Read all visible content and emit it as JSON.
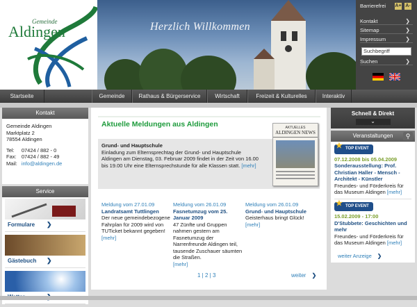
{
  "header": {
    "logo_line1": "Gemeinde",
    "logo_line2": "Aldingen",
    "welcome": "Herzlich Willkommen"
  },
  "util": {
    "barrierefrei": "Barrierefrei",
    "font_plus": "A+",
    "font_minus": "A-",
    "links": [
      "Kontakt",
      "Sitemap",
      "Impressum"
    ],
    "search_placeholder": "Suchbegriff",
    "search_button": "Suchen"
  },
  "nav": {
    "items": [
      "Startseite",
      "Gemeinde",
      "Rathaus & Bürgerservice",
      "Wirtschaft",
      "Freizeit & Kulturelles",
      "Interaktiv"
    ]
  },
  "contact": {
    "heading": "Kontakt",
    "name": "Gemeinde Aldingen",
    "street": "Marktplatz 2",
    "city": "78554 Aldingen",
    "tel_label": "Tel:",
    "tel": "07424 / 882 - 0",
    "fax_label": "Fax:",
    "fax": "07424 / 882 - 49",
    "mail_label": "Mail:",
    "mail": "info@aldingen.de"
  },
  "service": {
    "heading": "Service",
    "items": [
      "Formulare",
      "Gästebuch",
      "Wetter"
    ]
  },
  "main": {
    "title": "Aktuelle Meldungen aus Aldingen",
    "lead": {
      "title": "Grund- und Hauptschule",
      "body": "Einladung zum Elternsprechtag der Grund- und Hauptschule Aldingen am Dienstag, 03. Februar 2009 findet in der Zeit von 16.00 bis 19.00 Uhr eine Elternsprechstunde für alle Klassen statt.",
      "more": "[mehr]"
    },
    "paper_top": "AKTUELLES",
    "paper_title": "ALDINGEN NEWS",
    "news": [
      {
        "date": "Meldung vom 27.01.09",
        "title": "Landratsamt Tuttlingen",
        "body": "Der neue gemeindebezogene Fahrplan für 2009 wird von TUTicket bekannt gegeben!",
        "more": "[mehr]"
      },
      {
        "date": "Meldung vom 26.01.09",
        "title": "Fasnetumzug vom 25. Januar 2009",
        "body": "47 Zünfte und Gruppen nahmen gestern am Fasnetumzug der Narrenfreunde Aldingen teil, tausende Zuschauer säumten die Straßen.",
        "more": "[mehr]"
      },
      {
        "date": "Meldung vom 26.01.09",
        "title": "Grund- und Hauptschule",
        "body": "Geisterhaus bringt Glück!",
        "more": "[mehr]"
      }
    ],
    "pager": [
      "1",
      "2",
      "3"
    ],
    "weiter": "weiter"
  },
  "right": {
    "schnell": "Schnell & Direkt",
    "veranstaltungen": "Veranstaltungen",
    "top_event": "TOP EVENT",
    "events": [
      {
        "date": "07.12.2008 bis 05.04.2009",
        "title": "Sonderausstellung: Prof. Christian Haller - Mensch - Architekt - Künstler",
        "body": "Freundes- und Förderkreis für das Museum Aldingen",
        "more": "[mehr]"
      },
      {
        "date": "15.02.2009 - 17:00",
        "title": "D'Stubbete: Geschichten und mehr",
        "body": "Freundes- und Förderkreis für das Museum Aldingen",
        "more": "[mehr]"
      }
    ],
    "weiter_anzeige": "weiter Anzeige"
  }
}
